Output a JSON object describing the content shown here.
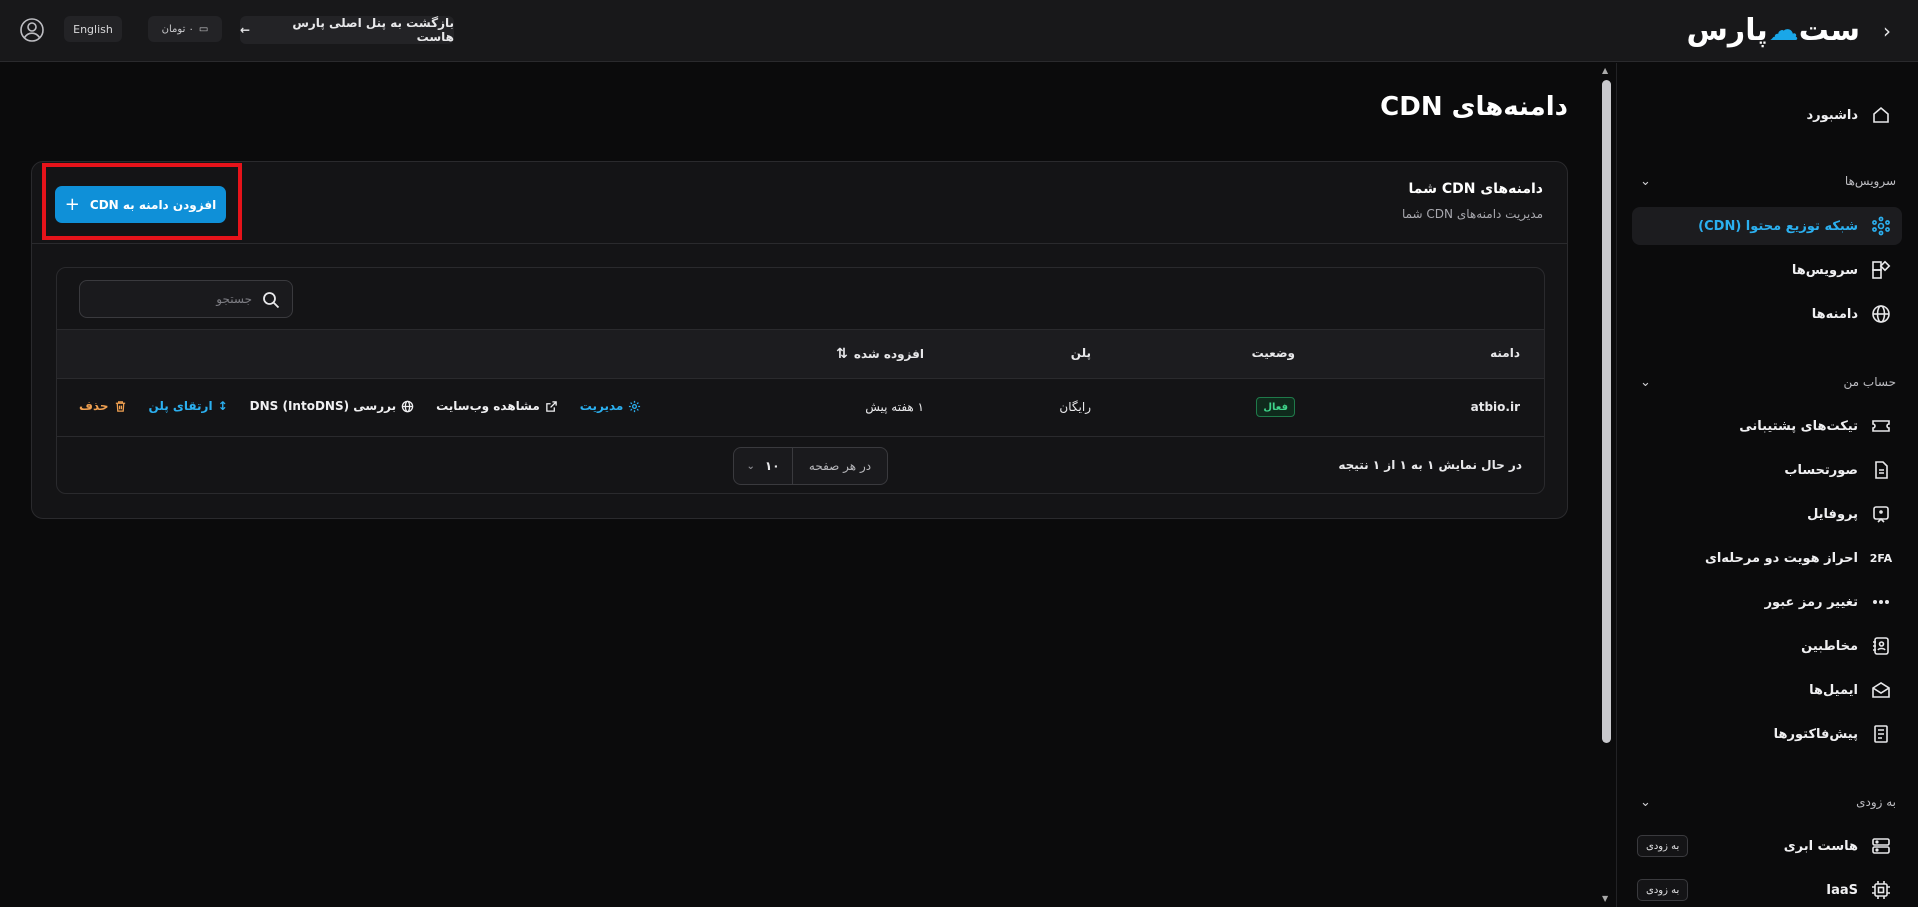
{
  "topbar": {
    "logo_main": "پارس",
    "logo_tail": "ست",
    "back_label": "بازگشت به پنل اصلی پارس هاست",
    "wallet_label": "۰ تومان",
    "lang_label": "English"
  },
  "sidebar": {
    "dashboard": "داشبورد",
    "services_section": "سرویس‌ها",
    "items_services": [
      {
        "label": "شبکه توزیع محتوا (CDN)",
        "icon": "cdn-icon",
        "active": true
      },
      {
        "label": "سرویس‌ها",
        "icon": "services-icon"
      },
      {
        "label": "دامنه‌ها",
        "icon": "globe-icon"
      }
    ],
    "account_section": "حساب من",
    "items_account": [
      {
        "label": "تیکت‌های پشتیبانی",
        "icon": "ticket-icon"
      },
      {
        "label": "صورتحساب",
        "icon": "invoice-icon"
      },
      {
        "label": "پروفایل",
        "icon": "profile-icon"
      },
      {
        "label": "احراز هویت دو مرحله‌ای",
        "icon": "2fa-icon",
        "icon_text": "2FA"
      },
      {
        "label": "تغییر رمز عبور",
        "icon": "password-icon"
      },
      {
        "label": "مخاطبین",
        "icon": "contacts-icon"
      },
      {
        "label": "ایمیل‌ها",
        "icon": "mail-icon"
      },
      {
        "label": "پیش‌فاکتورها",
        "icon": "proforma-icon"
      }
    ],
    "soon_section": "به زودی",
    "items_soon": [
      {
        "label": "هاست ابری",
        "icon": "server-icon",
        "badge": "به زودی"
      },
      {
        "label": "IaaS",
        "icon": "chip-icon",
        "badge": "به زودی"
      }
    ]
  },
  "main": {
    "page_title": "دامنه‌های CDN",
    "card_title": "دامنه‌های CDN شما",
    "card_subtitle": "مدیریت دامنه‌های CDN شما",
    "add_button": "افزودن دامنه به CDN",
    "search_placeholder": "جستجو",
    "columns": {
      "domain": "دامنه",
      "status": "وضعیت",
      "plan": "پلن",
      "added": "افزوده شده"
    },
    "rows": [
      {
        "domain": "atbio.ir",
        "status": "فعال",
        "plan": "رایگان",
        "added": "۱ هفته پیش",
        "actions": {
          "manage": "مدیریت",
          "view_site": "مشاهده وب‌سایت",
          "dns_check": "بررسی DNS (IntoDNS)",
          "upgrade": "ارتقای پلن",
          "delete": "حذف"
        }
      }
    ],
    "result_text": "در حال نمایش ۱ به ۱ از ۱ نتیجه",
    "per_page_label": "در هر صفحه",
    "per_page_value": "۱۰"
  },
  "colors": {
    "accent": "#0f90d8",
    "active_link": "#2bb0f0",
    "highlight": "#e6131a",
    "success": "#3fd48a",
    "danger": "#f0a050"
  }
}
